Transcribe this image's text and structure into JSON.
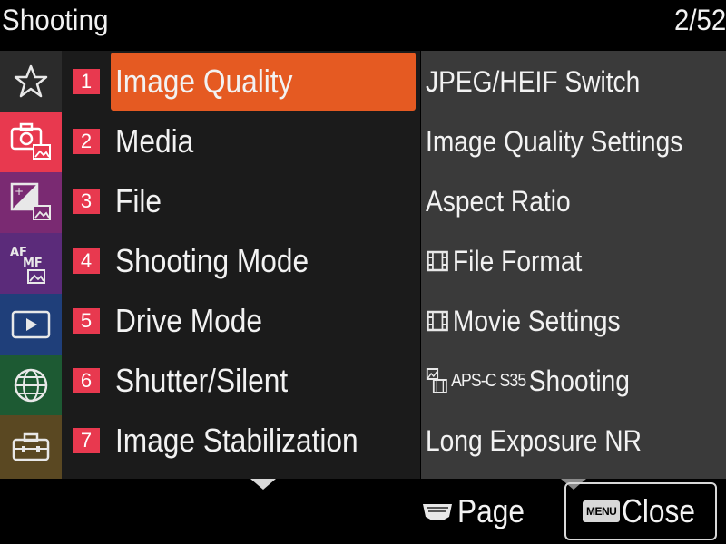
{
  "header": {
    "title": "Shooting",
    "page_indicator": "2/52"
  },
  "categories": [
    {
      "icon": "star-icon",
      "color": "#2b2b2b",
      "selected": false
    },
    {
      "icon": "camera-photo-icon",
      "color": "#e8394f",
      "selected": true
    },
    {
      "icon": "exposure-photo-icon",
      "color": "#7a2a72",
      "selected": false
    },
    {
      "icon": "af-mf-photo-icon",
      "color": "#5b2b7a",
      "selected": false
    },
    {
      "icon": "playback-icon",
      "color": "#1f3f7a",
      "selected": false
    },
    {
      "icon": "globe-icon",
      "color": "#1d5a33",
      "selected": false
    },
    {
      "icon": "toolbox-icon",
      "color": "#5a4822",
      "selected": false
    }
  ],
  "menu": {
    "items": [
      {
        "number": "1",
        "label": "Image Quality",
        "selected": true
      },
      {
        "number": "2",
        "label": "Media",
        "selected": false
      },
      {
        "number": "3",
        "label": "File",
        "selected": false
      },
      {
        "number": "4",
        "label": "Shooting Mode",
        "selected": false
      },
      {
        "number": "5",
        "label": "Drive Mode",
        "selected": false
      },
      {
        "number": "6",
        "label": "Shutter/Silent",
        "selected": false
      },
      {
        "number": "7",
        "label": "Image Stabilization",
        "selected": false
      }
    ]
  },
  "submenu": {
    "items": [
      {
        "label": "JPEG/HEIF Switch",
        "icon": null
      },
      {
        "label": "Image Quality Settings",
        "icon": null
      },
      {
        "label": "Aspect Ratio",
        "icon": null
      },
      {
        "label": "File Format",
        "icon": "movie-film-icon"
      },
      {
        "label": "Movie Settings",
        "icon": "movie-film-icon"
      },
      {
        "label": "Shooting",
        "icon": "apsc-photo-movie-icon",
        "prefix": "APS-C S35"
      },
      {
        "label": "Long Exposure NR",
        "icon": null
      }
    ]
  },
  "footer": {
    "page_label": "Page",
    "close_label": "Close",
    "menu_badge": "MENU"
  },
  "colors": {
    "highlight": "#e55a22",
    "number_badge": "#e8394f",
    "menu_bg": "#1b1b1b",
    "submenu_bg": "#3a3a3a"
  }
}
